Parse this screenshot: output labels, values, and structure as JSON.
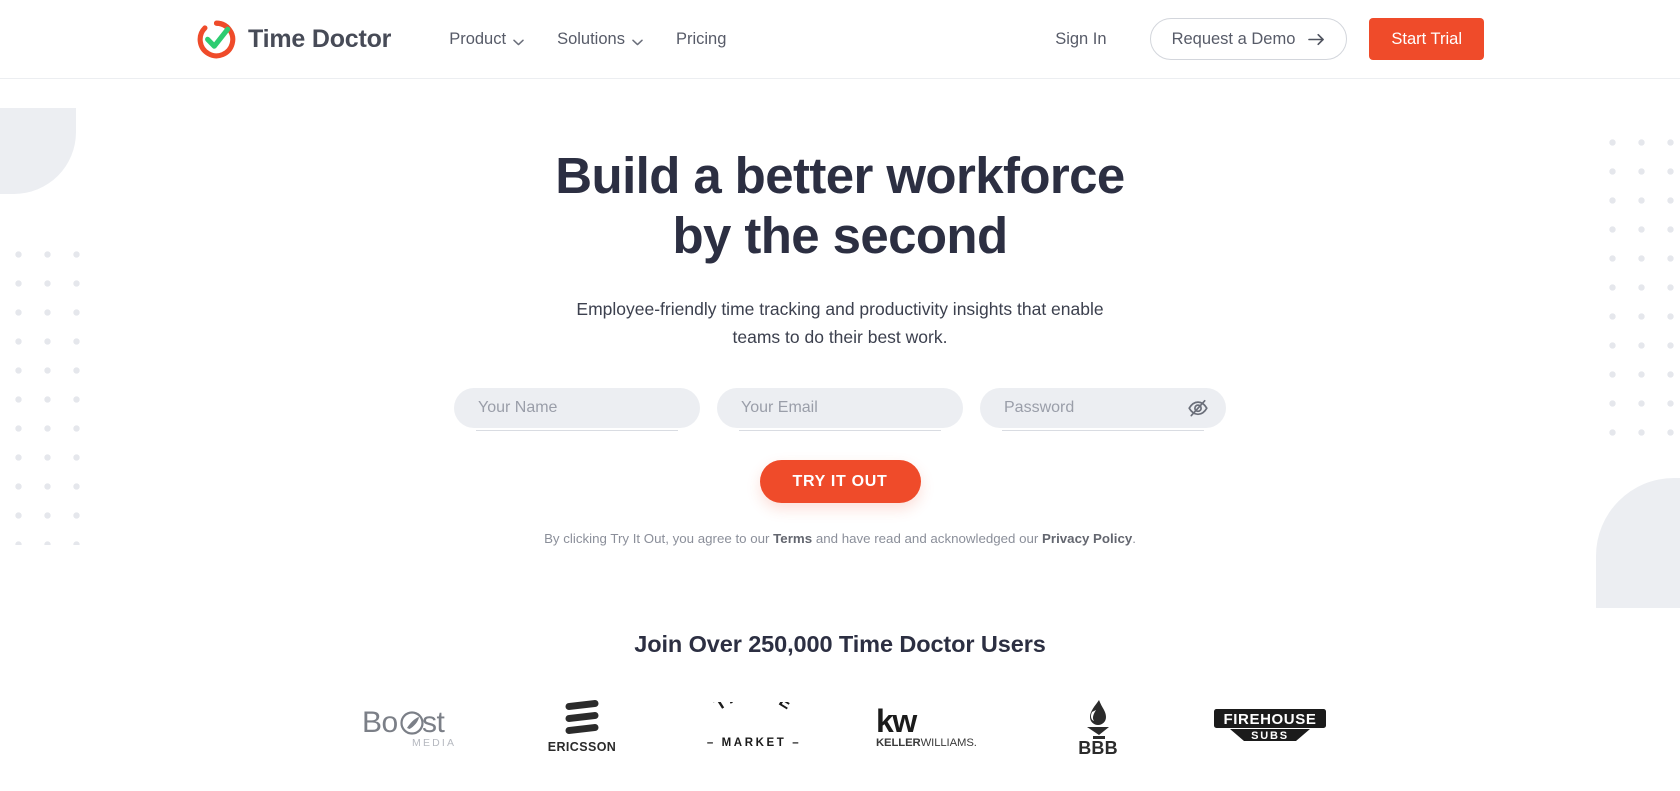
{
  "header": {
    "brand": {
      "name": "Time Doctor",
      "logo_icon": "time-doctor-check-circle-icon",
      "accent_orange": "#ef4b2a",
      "accent_green": "#2ecc71"
    },
    "nav": [
      {
        "label": "Product",
        "has_dropdown": true,
        "icon": "chevron-down-icon"
      },
      {
        "label": "Solutions",
        "has_dropdown": true,
        "icon": "chevron-down-icon"
      },
      {
        "label": "Pricing",
        "has_dropdown": false
      }
    ],
    "sign_in": "Sign In",
    "request_demo": {
      "label": "Request a Demo",
      "icon": "arrow-right-icon"
    },
    "start_trial": "Start Trial"
  },
  "hero": {
    "heading_line1": "Build a better workforce",
    "heading_line2": "by the second",
    "subheading_line1": "Employee-friendly time tracking and productivity insights that enable",
    "subheading_line2": "teams to do their best work.",
    "heading_color": "#2c2f42"
  },
  "form": {
    "fields": [
      {
        "name": "your-name",
        "placeholder": "Your Name",
        "value": "",
        "type": "text"
      },
      {
        "name": "your-email",
        "placeholder": "Your Email",
        "value": "",
        "type": "text"
      },
      {
        "name": "password",
        "placeholder": "Password",
        "value": "",
        "type": "password",
        "toggle_icon": "eye-slash-icon"
      }
    ],
    "submit_label": "TRY IT OUT",
    "submit_color": "#ef4b2a",
    "legal": {
      "prefix": "By clicking Try It Out, you agree to our",
      "terms_link": "Terms",
      "middle": "and have read and acknowledged our",
      "privacy_link": "Privacy Policy",
      "suffix": "."
    }
  },
  "social_proof": {
    "heading": "Join Over 250,000 Time Doctor Users",
    "logos": [
      {
        "name": "boost-media-logo",
        "primary": "Boost",
        "secondary": "MEDIA"
      },
      {
        "name": "ericsson-logo",
        "primary": "ERICSSON"
      },
      {
        "name": "thrive-market-logo",
        "primary": "THRIVE",
        "secondary": "MARKET"
      },
      {
        "name": "keller-williams-logo",
        "primary": "kw",
        "secondary": "KELLERWILLIAMS."
      },
      {
        "name": "bbb-logo",
        "primary": "BBB"
      },
      {
        "name": "firehouse-subs-logo",
        "primary": "FIREHOUSE",
        "secondary": "SUBS"
      }
    ]
  }
}
